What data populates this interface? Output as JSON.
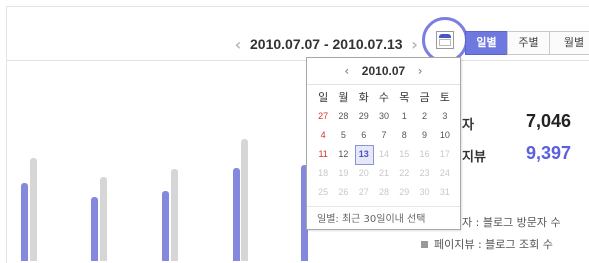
{
  "header": {
    "date_range": "2010.07.07 - 2010.07.13",
    "prev_label": "‹",
    "next_label": "›"
  },
  "tabs": [
    {
      "label": "일별",
      "active": true
    },
    {
      "label": "주별",
      "active": false
    },
    {
      "label": "월별",
      "active": false
    }
  ],
  "stats": {
    "visitors": {
      "label": "자",
      "value": "7,046",
      "color": "#222222"
    },
    "pageviews": {
      "label": "지뷰",
      "value": "9,397",
      "color": "#5b5fe0"
    }
  },
  "legend": [
    {
      "label": "자 : 블로그 방문자 수"
    },
    {
      "label": "페이지뷰 : 블로그 조회 수"
    }
  ],
  "calendar": {
    "month": "2010.07",
    "weekdays": [
      "일",
      "월",
      "화",
      "수",
      "목",
      "금",
      "토"
    ],
    "weeks": [
      [
        "27",
        "28",
        "29",
        "30",
        "1",
        "2",
        "3"
      ],
      [
        "4",
        "5",
        "6",
        "7",
        "8",
        "9",
        "10"
      ],
      [
        "11",
        "12",
        "13",
        "14",
        "15",
        "16",
        "17"
      ],
      [
        "18",
        "19",
        "20",
        "21",
        "22",
        "23",
        "24"
      ],
      [
        "25",
        "26",
        "27",
        "28",
        "29",
        "30",
        "31"
      ]
    ],
    "selected": "13",
    "footer": "일별: 최근 30일이내 선택"
  },
  "colors": {
    "accent": "#6f78de",
    "bar_blue": "#8589dd",
    "bar_gray": "#d6d6d6",
    "sunday": "#d6322a"
  }
}
